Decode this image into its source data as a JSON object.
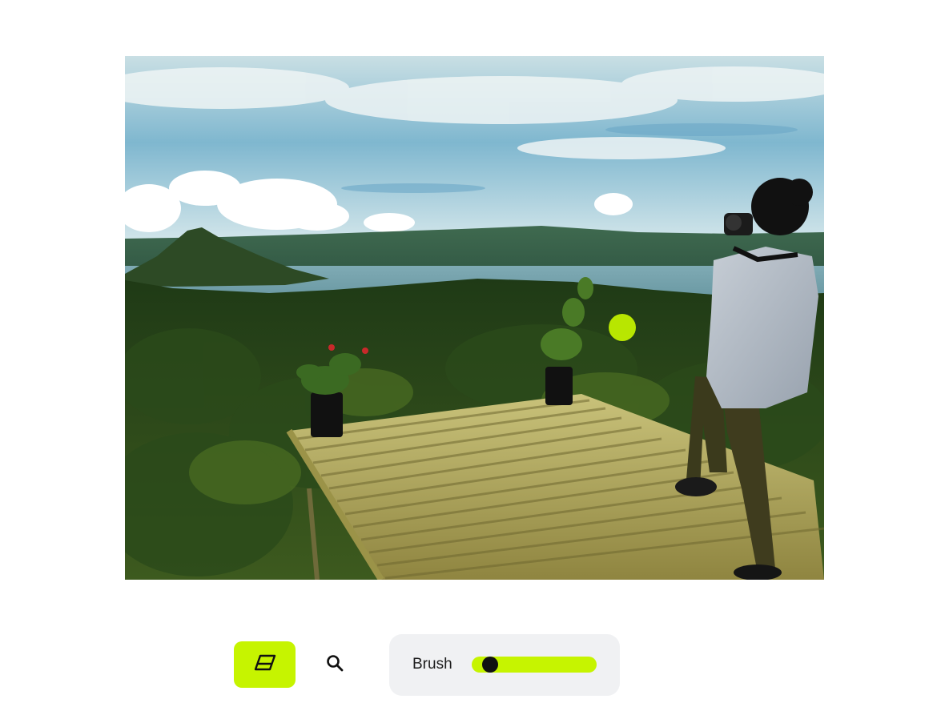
{
  "canvas": {
    "photo_description": "lakeside-volcano-photographer"
  },
  "toolbar": {
    "eraser_icon": "eraser-icon",
    "zoom_icon": "search-icon",
    "accent_color": "#c6f400",
    "brush": {
      "label": "Brush",
      "size_fraction": 0.08
    }
  }
}
